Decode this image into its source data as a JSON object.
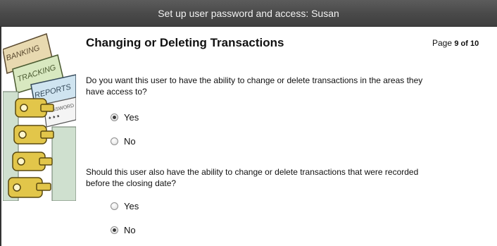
{
  "window": {
    "title": "Set up user password and access: Susan"
  },
  "header": {
    "heading": "Changing or Deleting Transactions",
    "page_label": "Page",
    "page_value": "9 of 10"
  },
  "illustration": {
    "signs": [
      "BANKING",
      "TRACKING",
      "REPORTS",
      "PASSWORD",
      "* * *"
    ],
    "icon": "keys-and-signs-icon"
  },
  "question1": {
    "text": "Do you want this user to have the ability to change or delete transactions in the areas they have access to?",
    "options": [
      {
        "label": "Yes",
        "checked": true
      },
      {
        "label": "No",
        "checked": false
      }
    ]
  },
  "question2": {
    "text": "Should this user also have the ability to change or delete transactions that were recorded before the closing date?",
    "options": [
      {
        "label": "Yes",
        "checked": false
      },
      {
        "label": "No",
        "checked": true
      }
    ]
  }
}
